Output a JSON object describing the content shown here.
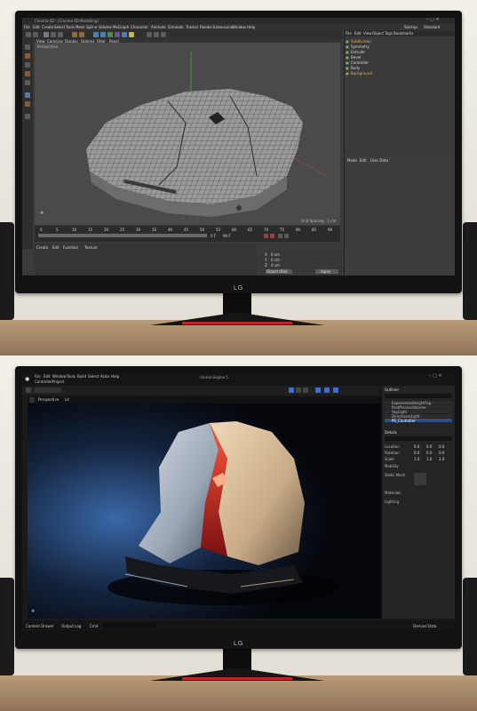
{
  "top_monitor": {
    "brand": "LG",
    "app_title": "Cinema 4D - [Cinema 4D Modelling]",
    "menu_items": [
      "File",
      "Edit",
      "Create",
      "Select",
      "Tools",
      "Mesh",
      "Spline",
      "Volume",
      "MoGraph",
      "Character",
      "Animate",
      "Simulate",
      "Tracker",
      "Render",
      "Extensions",
      "Window",
      "Help"
    ],
    "layout_tabs": [
      "Startup",
      "Standard"
    ],
    "viewport_menu": [
      "View",
      "Cameras",
      "Display",
      "Options",
      "Filter",
      "Panel"
    ],
    "viewport_label": "Perspective",
    "viewport_footer": "Grid Spacing : 1 cm",
    "objects_panel_tabs": [
      "File",
      "Edit",
      "View",
      "Object",
      "Tags",
      "Bookmarks"
    ],
    "objects": [
      "Subdivision",
      "Symmetry",
      "Extrude",
      "Bevel",
      "Controller",
      "Body",
      "Background"
    ],
    "attributes_tabs": [
      "Mode",
      "Edit",
      "User Data"
    ],
    "timeline_frames": [
      "0",
      "5",
      "10",
      "15",
      "20",
      "25",
      "30",
      "35",
      "40",
      "45",
      "50",
      "55",
      "60",
      "65",
      "70",
      "75",
      "80",
      "85",
      "90"
    ],
    "timeline_start": "0 F",
    "timeline_end": "90 F",
    "material_menu": [
      "Create",
      "Edit",
      "Function",
      "Texture"
    ],
    "coords": {
      "labels": [
        "X",
        "Y",
        "Z"
      ],
      "values": [
        "0 cm",
        "0 cm",
        "0 cm"
      ],
      "apply": "Apply",
      "mode": "Object (Rel)"
    }
  },
  "bottom_monitor": {
    "brand": "LG",
    "app_title": "Unreal Engine 5",
    "menu_items": [
      "File",
      "Edit",
      "Window",
      "Tools",
      "Build",
      "Select",
      "Actor",
      "Help"
    ],
    "project_tab": "ControllerProject",
    "toolbar_button": "Perspective",
    "lit_button": "Lit",
    "right_panel_title": "Outliner",
    "outliner_items": [
      "ExponentialHeightFog",
      "PostProcessVolume",
      "SkyLight",
      "DirectionalLight",
      "PS_Controller"
    ],
    "details_title": "Details",
    "details_fields": [
      "Location",
      "Rotation",
      "Scale",
      "Mobility",
      "Static Mesh",
      "Materials",
      "Lighting"
    ],
    "transform_values": [
      "0.0",
      "0.0",
      "0.0",
      "0.0",
      "0.0",
      "0.0",
      "1.0",
      "1.0",
      "1.0"
    ],
    "status_items": [
      "Content Drawer",
      "Output Log",
      "Cmd"
    ],
    "status_right": "Derived Data"
  },
  "colors": {
    "desk": "#a5876a",
    "wall": "#ece8e2",
    "c4d_bg": "#3a3a3a",
    "ue_bg": "#1a1a1a",
    "accent_red": "#e0322e"
  }
}
